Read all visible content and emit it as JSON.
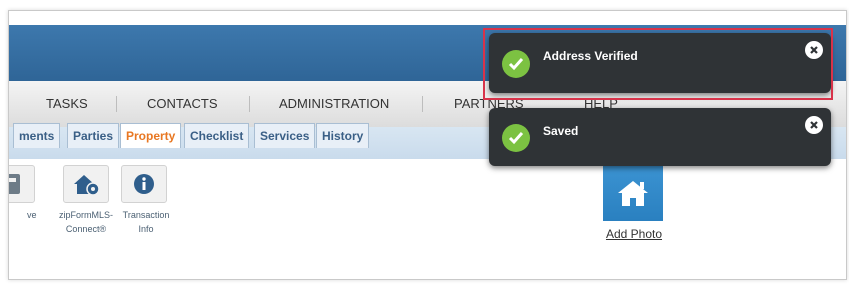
{
  "nav": {
    "items": [
      "TASKS",
      "CONTACTS",
      "ADMINISTRATION",
      "PARTNERS",
      "HELP"
    ]
  },
  "tabs": [
    "ments",
    "Parties",
    "Property",
    "Checklist",
    "Services",
    "History"
  ],
  "active_tab": "Property",
  "toolbar": {
    "tiles": [
      {
        "icon": "document-icon",
        "label": "ve"
      },
      {
        "icon": "house-gear-icon",
        "label": "zipFormMLS-Connect®"
      },
      {
        "icon": "info-icon",
        "label": "Transaction Info"
      }
    ],
    "tile2_label_line1": "zipFormMLS-",
    "tile2_label_line2": "Connect®",
    "tile3_label_line1": "Transaction",
    "tile3_label_line2": "Info"
  },
  "photo": {
    "label": "Add Photo",
    "icon": "house-icon"
  },
  "notifications": [
    {
      "message": "Address Verified",
      "icon": "check-icon",
      "close_icon": "close-icon"
    },
    {
      "message": "Saved",
      "icon": "check-icon",
      "close_icon": "close-icon"
    }
  ],
  "colors": {
    "header": "#2f6597",
    "active_tab": "#e87722",
    "toast_bg": "#2f3336",
    "check": "#7cc242",
    "highlight": "#d8334a"
  }
}
